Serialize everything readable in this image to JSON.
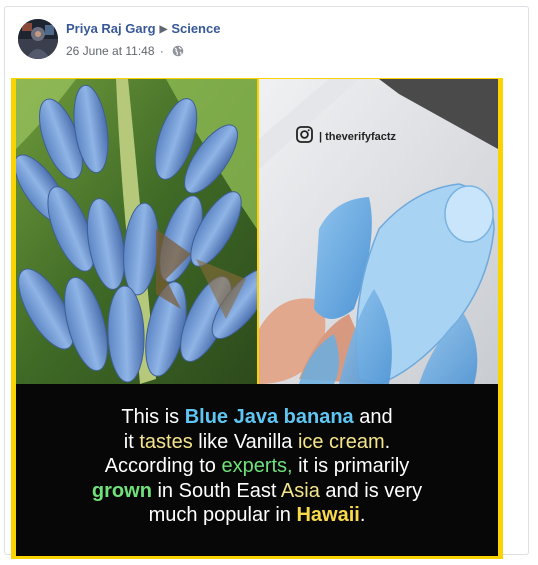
{
  "post": {
    "author": "Priya Raj Garg",
    "group": "Science",
    "timestamp": "26 June at 11:48",
    "separator": "·",
    "audience_icon": "globe-icon"
  },
  "image": {
    "watermark_handle": "| theverifyfactz",
    "watermark_icon": "instagram-icon",
    "caption": {
      "line1": {
        "a": "This is ",
        "b": "Blue Java banana",
        "c": " and"
      },
      "line2": {
        "a": "it ",
        "b": "tastes",
        "c": " like Vanilla ",
        "d": "ice cream",
        "e": "."
      },
      "line3": {
        "a": "According to ",
        "b": "experts,",
        "c": " it is primarily"
      },
      "line4": {
        "a": "grown",
        "b": " in South East ",
        "c": "Asia",
        "d": " and is very"
      },
      "line5": {
        "a": "much popular in ",
        "b": "Hawaii",
        "c": "."
      }
    }
  },
  "colors": {
    "link": "#385898",
    "frame": "#fbd400",
    "caption_bg": "#070708",
    "highlight_blue": "#5fc6f2",
    "highlight_green": "#6fe07a",
    "highlight_gold": "#f8d94a"
  }
}
